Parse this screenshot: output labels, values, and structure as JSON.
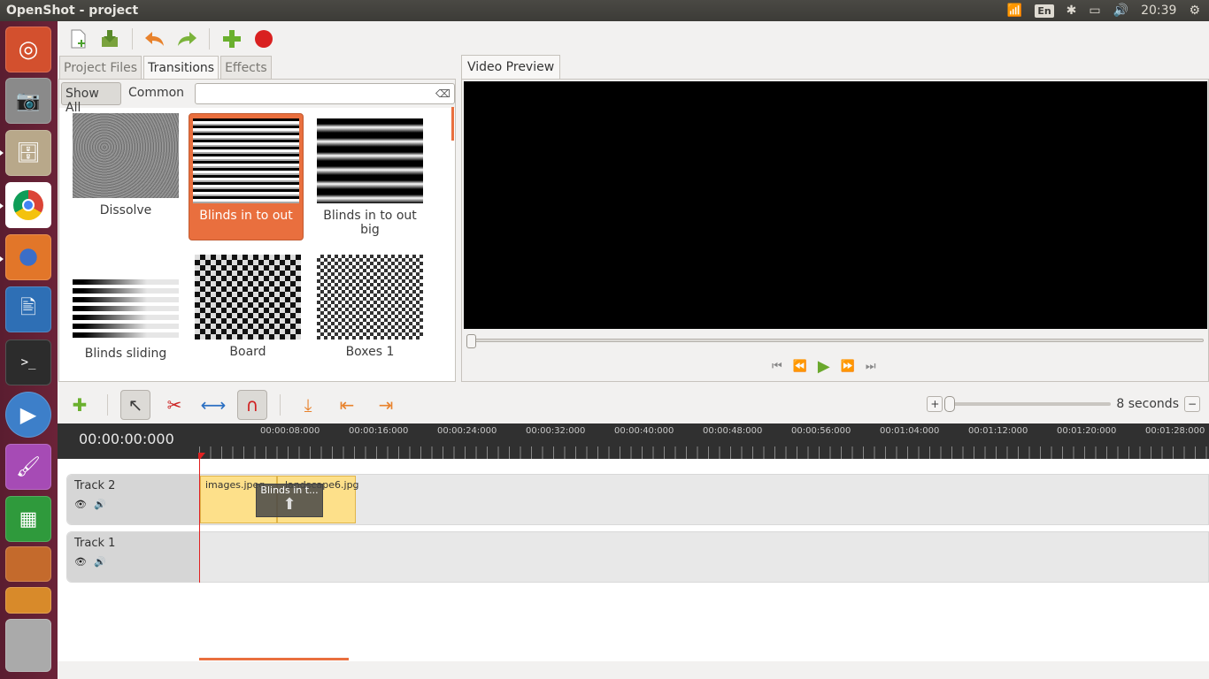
{
  "window": {
    "title": "OpenShot - project"
  },
  "panel": {
    "keyboard": "En",
    "clock": "20:39"
  },
  "launcher": [
    {
      "name": "ubuntu-dash",
      "color": "#d3502e"
    },
    {
      "name": "camera-app",
      "color": "#8a8a8a"
    },
    {
      "name": "files-app",
      "color": "#b8a88a"
    },
    {
      "name": "chrome-browser",
      "color": "#4a8fd9"
    },
    {
      "name": "firefox-browser",
      "color": "#e27629"
    },
    {
      "name": "writer-app",
      "color": "#2e6fb5"
    },
    {
      "name": "terminal-app",
      "color": "#2c2c2c"
    },
    {
      "name": "openshot-app",
      "color": "#3d7fc9"
    },
    {
      "name": "paint-app",
      "color": "#a64bb5"
    },
    {
      "name": "calc-app",
      "color": "#2f9a3c"
    }
  ],
  "tabs": [
    "Project Files",
    "Transitions",
    "Effects"
  ],
  "filter": {
    "show_all": "Show All",
    "common": "Common",
    "search_placeholder": ""
  },
  "transitions": [
    {
      "label": "Dissolve"
    },
    {
      "label": "Blinds in to out"
    },
    {
      "label": "Blinds in to out big"
    },
    {
      "label": "Blinds sliding"
    },
    {
      "label": "Board"
    },
    {
      "label": "Boxes 1"
    }
  ],
  "preview": {
    "tab": "Video Preview"
  },
  "timeline": {
    "zoom_label": "8 seconds",
    "timecode": "00:00:00:000",
    "ticks": [
      "00:00:08:000",
      "00:00:16:000",
      "00:00:24:000",
      "00:00:32:000",
      "00:00:40:000",
      "00:00:48:000",
      "00:00:56:000",
      "00:01:04:000",
      "00:01:12:000",
      "00:01:20:000",
      "00:01:28:000"
    ],
    "tracks": [
      {
        "name": "Track 2",
        "clips": [
          "images.jpeg",
          "landscape6.jpg"
        ],
        "transition": "Blinds in t..."
      },
      {
        "name": "Track 1"
      }
    ]
  }
}
